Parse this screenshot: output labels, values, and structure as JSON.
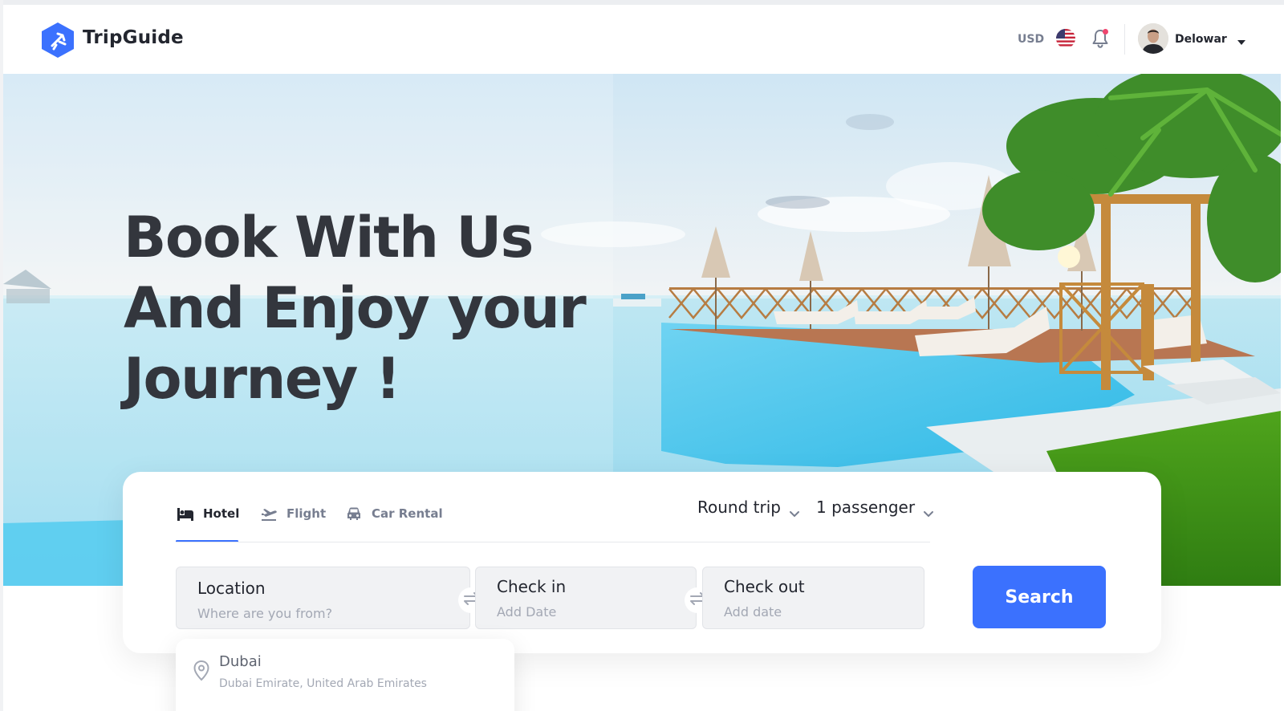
{
  "brand": {
    "name": "TripGuide",
    "accent": "#3b71fe"
  },
  "header": {
    "currency": "USD",
    "flag_icon": "us-flag-icon",
    "notification_icon": "bell-icon",
    "user": {
      "name": "Delowar",
      "menu_icon": "caret-down-icon"
    }
  },
  "hero": {
    "title_line1": "Book With Us",
    "title_line2": "And Enjoy your",
    "title_line3": "Journey !"
  },
  "search": {
    "tabs": [
      {
        "label": "Hotel",
        "icon": "bed-icon",
        "active": true
      },
      {
        "label": "Flight",
        "icon": "plane-departure-icon",
        "active": false
      },
      {
        "label": "Car Rental",
        "icon": "car-icon",
        "active": false
      }
    ],
    "trip_type": "Round trip",
    "passengers": "1 passenger",
    "fields": {
      "location": {
        "label": "Location",
        "placeholder": "Where are you from?"
      },
      "check_in": {
        "label": "Check in",
        "placeholder": "Add Date"
      },
      "check_out": {
        "label": "Check out",
        "placeholder": "Add date"
      }
    },
    "button": "Search"
  },
  "suggestions": [
    {
      "name": "Dubai",
      "sub": "Dubai Emirate, United Arab Emirates",
      "icon": "map-pin-icon"
    }
  ]
}
